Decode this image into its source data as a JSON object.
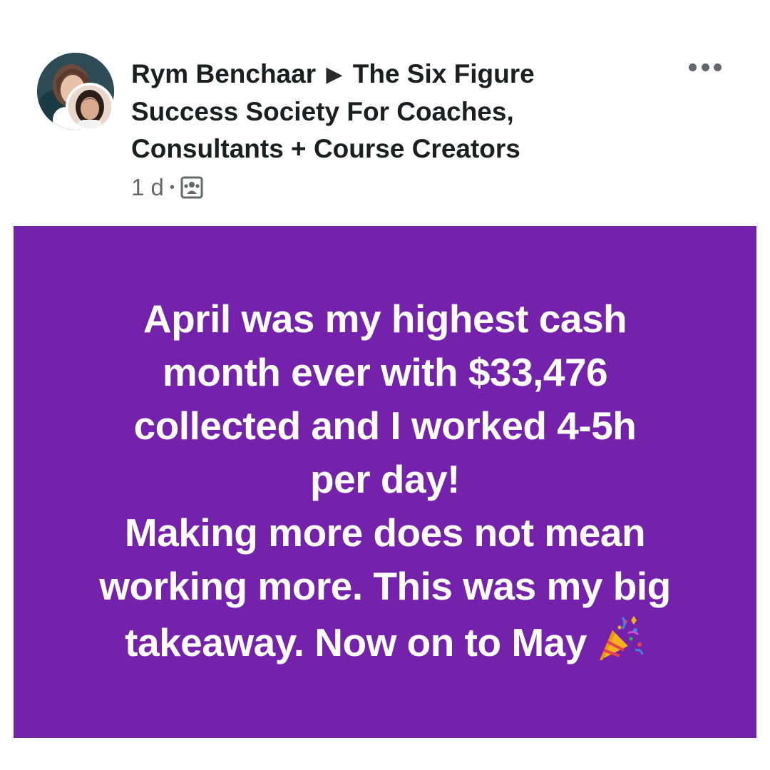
{
  "post": {
    "author": "Rym Benchaar",
    "arrow_glyph": "▶",
    "group_name_line1": "The Six Figure",
    "group_name_line2": "Success Society For Coaches,",
    "group_name_line3": "Consultants + Course Creators",
    "timestamp": "1 d",
    "separator": "•",
    "privacy_icon": "group-icon",
    "more_icon": "more-options-icon"
  },
  "card": {
    "background": "#7422ab",
    "text_color": "#ffffff",
    "lines": [
      "April was my highest cash",
      "month ever with $33,476",
      "collected and I worked 4-5h",
      "per day!",
      "Making more does not mean",
      "working more. This was my big",
      "takeaway. Now on to May"
    ],
    "end_emoji": "party-popper-icon"
  }
}
